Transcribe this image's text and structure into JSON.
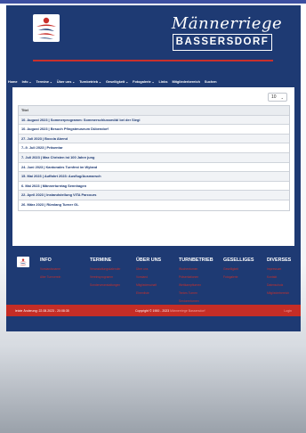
{
  "header": {
    "title_script": "Männerriege",
    "title_box": "BASSERSDORF",
    "colors": {
      "bg": "#1e3a73",
      "accent": "#c9302c"
    }
  },
  "nav": {
    "items": [
      {
        "label": "Home",
        "chevron": false
      },
      {
        "label": "Info",
        "chevron": true
      },
      {
        "label": "Termine",
        "chevron": true
      },
      {
        "label": "Über uns",
        "chevron": true
      },
      {
        "label": "Turnbetrieb",
        "chevron": true
      },
      {
        "label": "Geselligkeit",
        "chevron": true
      },
      {
        "label": "Fotogalerie",
        "chevron": true
      },
      {
        "label": "Links",
        "chevron": false
      },
      {
        "label": "Mitgliederbereich",
        "chevron": false
      },
      {
        "label": "Suchen",
        "chevron": false
      }
    ]
  },
  "list": {
    "page_size": "10",
    "header": "Titel",
    "rows": [
      "10. August 2023 | Sommerprogramm: Sommerschlussmöbl bei der Siegi",
      "10. August 2023 | Besuch Pfingstmuseum Dübendorf",
      "27. Juli 2023 | Boccia Abend",
      "7.-9. Juli 2023 | Präsentar",
      "7. Juli 2023 | Max Christen ist 100 Jahre jung",
      "24. Juni 2023 | Kantonales Turnfest im Wyland",
      "15. Mai 2023 | Auffahrt 2023: Ausflug/Ausmarsch",
      "6. Mai 2023 | Männerturntag Sennhagen",
      "22. April 2023 | Instandstellung VITA Parcours",
      "26. März 2023 | Rümlang Turner GL"
    ]
  },
  "footer": {
    "columns": [
      {
        "title": "INFO",
        "links": [
          "Vorstandsname",
          "Alter Turnverein"
        ]
      },
      {
        "title": "TERMINE",
        "links": [
          "Veranstaltungskalender",
          "Vereinsprogramm",
          "Sonderveranstaltungen"
        ]
      },
      {
        "title": "ÜBER UNS",
        "links": [
          "Über uns",
          "Vorstand",
          "Mitgliederschaft",
          "Ehrenliste"
        ]
      },
      {
        "title": "TURNBETRIEB",
        "links": [
          "Wochenturnen",
          "Präsentationen",
          "Wettkampfturnen",
          "Tentes Turnen",
          "Seniorenturnen",
          "Bewegungsabende"
        ]
      },
      {
        "title": "GESELLIGES",
        "links": [
          "Geselligkeit",
          "Fotogalerie"
        ]
      },
      {
        "title": "DIVERSES",
        "links": [
          "Impressum",
          "Kontakt",
          "Datenschutz",
          "Mitgliederbereich"
        ]
      }
    ]
  },
  "bottom": {
    "last_change": "letzte Änderung: 22.08.2023 - 20:08:35",
    "copyright": "Copyright © 1900 - 2023",
    "copyright_sub": "Männerriege Bassersdorf",
    "right": "Login"
  }
}
